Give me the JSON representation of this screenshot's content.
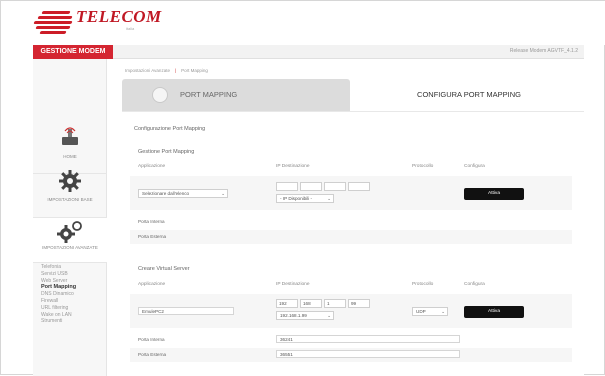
{
  "brand": {
    "name": "TELECOM",
    "sub": "italia"
  },
  "header": {
    "title": "GESTIONE MODEM",
    "release": "Release Modem AGVTF_4.1.2"
  },
  "breadcrumb": {
    "item1": "Impostazioni Avanzate",
    "item2": "Port Mapping"
  },
  "tabs": {
    "tab1": "PORT MAPPING",
    "tab2": "CONFIGURA PORT MAPPING"
  },
  "sidebar": {
    "blocks": [
      {
        "label": "HOME"
      },
      {
        "label": "IMPOSTAZIONI BASE"
      },
      {
        "label": "IMPOSTAZIONI AVANZATE"
      }
    ],
    "menu": [
      "Telefonia",
      "Servizi USB",
      "Web Server",
      "Port Mapping",
      "DNS Dinamico",
      "Firewall",
      "URL filtering",
      "Wake on LAN",
      "Strumenti"
    ]
  },
  "config": {
    "title": "Configurazione Port Mapping",
    "gestione": {
      "title": "Gestione Port Mapping",
      "col_app": "Applicazione",
      "col_ip": "IP Destinazione",
      "col_proto": "Protocollo",
      "col_conf": "Configura",
      "app_select": "Selezionare dall'elenco",
      "ip_select": "- IP Disponibili -",
      "button": "Attiva",
      "porta_interna": "Porta Interna",
      "porta_esterna": "Porta Esterna"
    },
    "virtual": {
      "title": "Creare Virtual Server",
      "col_app": "Applicazione",
      "col_ip": "IP Destinazione",
      "col_proto": "Protocollo",
      "col_conf": "Configura",
      "app_value": "EmulePC2",
      "ip1": "192",
      "ip2": "168",
      "ip3": "1",
      "ip4": "99",
      "ip_select": "192.168.1.99",
      "proto_value": "UDP",
      "button": "Attiva",
      "porta_interna_label": "Porta Interna",
      "porta_interna_value": "36241",
      "porta_esterna_label": "Porta Esterna",
      "porta_esterna_value": "36551"
    }
  },
  "colors": {
    "accent": "#d42531",
    "button": "#111111"
  }
}
